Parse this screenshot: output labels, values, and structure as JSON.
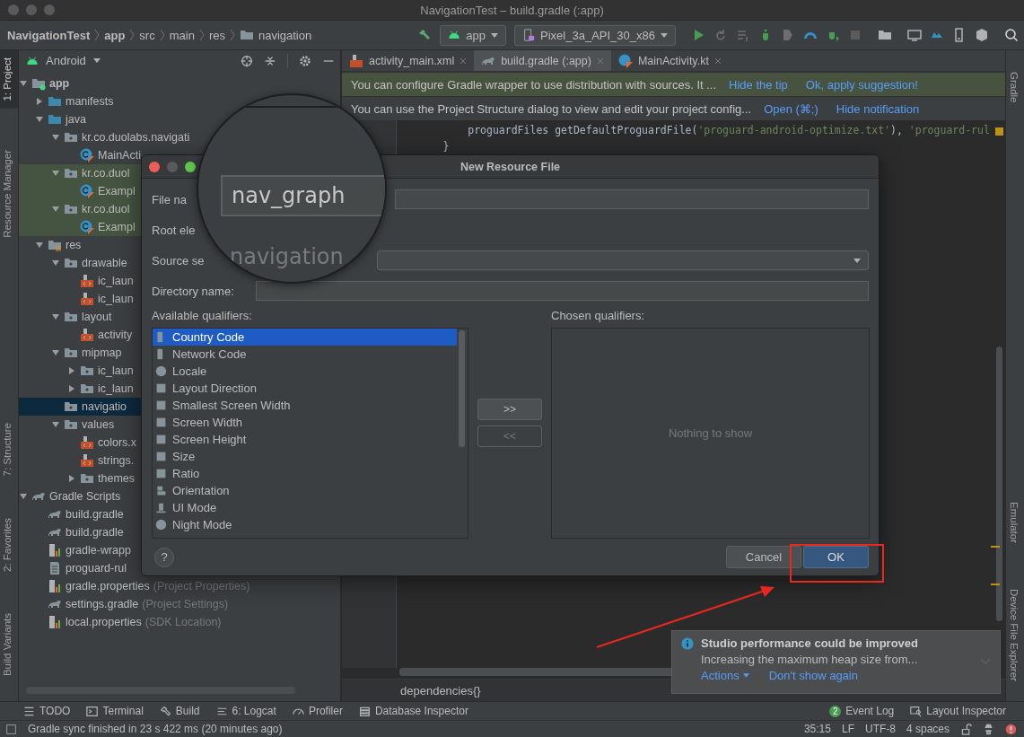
{
  "window": {
    "title": "NavigationTest – build.gradle (:app)"
  },
  "breadcrumbs": [
    {
      "label": "NavigationTest",
      "bold": true,
      "kind": "text"
    },
    {
      "label": "app",
      "bold": true,
      "kind": "text"
    },
    {
      "label": "src",
      "bold": false,
      "kind": "text"
    },
    {
      "label": "main",
      "bold": false,
      "kind": "text"
    },
    {
      "label": "res",
      "bold": false,
      "kind": "text"
    },
    {
      "label": "navigation",
      "bold": false,
      "kind": "folder"
    }
  ],
  "run_config": {
    "module": "app",
    "device": "Pixel_3a_API_30_x86"
  },
  "left_stripe_top": [
    {
      "label": "1: Project",
      "selected": true
    },
    {
      "label": "Resource Manager",
      "selected": false
    }
  ],
  "left_stripe_bottom": [
    {
      "label": "7: Structure",
      "selected": false
    },
    {
      "label": "2: Favorites",
      "selected": false
    },
    {
      "label": "Build Variants",
      "selected": false
    }
  ],
  "project_panel": {
    "view": "Android",
    "tree": [
      {
        "label": "app",
        "kind": "module",
        "expanded": true,
        "selected": false,
        "tinted": false,
        "children": [
          {
            "label": "manifests",
            "kind": "folder",
            "expanded": false,
            "selected": false,
            "tinted": false
          },
          {
            "label": "java",
            "kind": "folder",
            "expanded": true,
            "selected": false,
            "tinted": false,
            "children": [
              {
                "label": "kr.co.duolabs.navigati",
                "kind": "package",
                "expanded": true,
                "selected": false,
                "tinted": false,
                "children": [
                  {
                    "label": "MainActi",
                    "kind": "kotlin",
                    "selected": false,
                    "tinted": false
                  }
                ]
              },
              {
                "label": "kr.co.duol",
                "kind": "package",
                "expanded": true,
                "selected": false,
                "tinted": true,
                "children": [
                  {
                    "label": "Exampl",
                    "kind": "kotlin",
                    "selected": false,
                    "tinted": true
                  }
                ]
              },
              {
                "label": "kr.co.duol",
                "kind": "package",
                "expanded": true,
                "selected": false,
                "tinted": true,
                "children": [
                  {
                    "label": "Exampl",
                    "kind": "kotlin",
                    "selected": false,
                    "tinted": true
                  }
                ]
              }
            ]
          },
          {
            "label": "res",
            "kind": "res",
            "expanded": true,
            "selected": false,
            "tinted": false,
            "children": [
              {
                "label": "drawable",
                "kind": "package",
                "expanded": true,
                "selected": false,
                "tinted": false,
                "children": [
                  {
                    "label": "ic_laun",
                    "kind": "xml",
                    "selected": false,
                    "tinted": false
                  },
                  {
                    "label": "ic_laun",
                    "kind": "xml",
                    "selected": false,
                    "tinted": false
                  }
                ]
              },
              {
                "label": "layout",
                "kind": "package",
                "expanded": true,
                "selected": false,
                "tinted": false,
                "children": [
                  {
                    "label": "activity",
                    "kind": "xml",
                    "selected": false,
                    "tinted": false
                  }
                ]
              },
              {
                "label": "mipmap",
                "kind": "package",
                "expanded": true,
                "selected": false,
                "tinted": false,
                "children": [
                  {
                    "label": "ic_laun",
                    "kind": "package",
                    "expanded": false,
                    "selected": false,
                    "tinted": false
                  },
                  {
                    "label": "ic_laun",
                    "kind": "package",
                    "expanded": false,
                    "selected": false,
                    "tinted": false
                  }
                ]
              },
              {
                "label": "navigatio",
                "kind": "package",
                "selected": true,
                "tinted": false
              },
              {
                "label": "values",
                "kind": "package",
                "expanded": true,
                "selected": false,
                "tinted": false,
                "children": [
                  {
                    "label": "colors.x",
                    "kind": "xml",
                    "selected": false,
                    "tinted": false
                  },
                  {
                    "label": "strings.",
                    "kind": "xml",
                    "selected": false,
                    "tinted": false
                  },
                  {
                    "label": "themes",
                    "kind": "package",
                    "expanded": false,
                    "selected": false,
                    "tinted": false
                  }
                ]
              }
            ]
          }
        ]
      },
      {
        "label": "Gradle Scripts",
        "kind": "gradle",
        "expanded": true,
        "selected": false,
        "tinted": false,
        "children": [
          {
            "label": "build.gradle",
            "kind": "gradle",
            "selected": false,
            "tinted": false
          },
          {
            "label": "build.gradle",
            "kind": "gradle",
            "selected": false,
            "tinted": false
          },
          {
            "label": "gradle-wrapp",
            "kind": "properties",
            "selected": false,
            "tinted": false
          },
          {
            "label": "proguard-rul",
            "kind": "text",
            "selected": false,
            "tinted": false
          },
          {
            "label": "gradle.properties",
            "note": "(Project Properties)",
            "kind": "properties",
            "selected": false,
            "tinted": false
          },
          {
            "label": "settings.gradle",
            "note": "(Project Settings)",
            "kind": "gradle",
            "selected": false,
            "tinted": false
          },
          {
            "label": "local.properties",
            "note": "(SDK Location)",
            "kind": "properties",
            "selected": false,
            "tinted": false
          }
        ]
      }
    ]
  },
  "editor_tabs": [
    {
      "label": "activity_main.xml",
      "kind": "xml",
      "selected": false
    },
    {
      "label": "build.gradle (:app)",
      "kind": "gradle",
      "selected": true
    },
    {
      "label": "MainActivity.kt",
      "kind": "kotlin",
      "selected": false
    }
  ],
  "banners": [
    {
      "kind": "tip",
      "text": "You can configure Gradle wrapper to use distribution with sources. It ...",
      "links": [
        "Hide the tip",
        "Ok, apply suggestion!"
      ]
    },
    {
      "kind": "info",
      "text": "You can use the Project Structure dialog to view and edit your project config...",
      "links": [
        "Open (⌘;)",
        "Hide notification"
      ]
    }
  ],
  "code_lines": [
    {
      "segments": [
        {
          "kind": "plain",
          "text": "          proguardFiles getDefaultProguardFile("
        },
        {
          "kind": "string",
          "text": "'proguard-android-optimize.txt'"
        },
        {
          "kind": "plain",
          "text": "), "
        },
        {
          "kind": "string",
          "text": "'proguard-rul"
        }
      ]
    },
    {
      "segments": [
        {
          "kind": "plain",
          "text": "      }"
        }
      ]
    }
  ],
  "editor_breadcrumb": "dependencies{}",
  "dialog": {
    "title": "New Resource File",
    "fields": [
      {
        "label": "File na",
        "kind": "text"
      },
      {
        "label": "Root ele",
        "kind": "label"
      },
      {
        "label": "Source se",
        "kind": "select"
      },
      {
        "label": "Directory name:",
        "kind": "text"
      }
    ],
    "available_label": "Available qualifiers:",
    "qualifiers": [
      {
        "label": "Country Code",
        "selected": true
      },
      {
        "label": "Network Code",
        "selected": false
      },
      {
        "label": "Locale",
        "selected": false
      },
      {
        "label": "Layout Direction",
        "selected": false
      },
      {
        "label": "Smallest Screen Width",
        "selected": false
      },
      {
        "label": "Screen Width",
        "selected": false
      },
      {
        "label": "Screen Height",
        "selected": false
      },
      {
        "label": "Size",
        "selected": false
      },
      {
        "label": "Ratio",
        "selected": false
      },
      {
        "label": "Orientation",
        "selected": false
      },
      {
        "label": "UI Mode",
        "selected": false
      },
      {
        "label": "Night Mode",
        "selected": false
      }
    ],
    "add_button": {
      "label": ">>",
      "disabled": false
    },
    "remove_button": {
      "label": "<<",
      "disabled": true
    },
    "chosen_label": "Chosen qualifiers:",
    "empty_text": "Nothing to show",
    "help": "?",
    "cancel": "Cancel",
    "ok": "OK"
  },
  "magnifier": {
    "file_name": "nav_graph",
    "root_element": "navigation"
  },
  "notification": {
    "title": "Studio performance could be improved",
    "body": "Increasing the maximum heap size from...",
    "actions": "Actions",
    "dismiss": "Don't show again"
  },
  "right_stripe": [
    {
      "label": "Gradle"
    },
    {
      "label": "Emulator"
    },
    {
      "label": "Device File Explorer"
    }
  ],
  "bottom_tools_left": [
    "TODO",
    "Terminal",
    "Build",
    "6: Logcat",
    "Profiler",
    "Database Inspector"
  ],
  "bottom_tools_right": [
    {
      "label": "Event Log",
      "badge": "2"
    },
    {
      "label": "Layout Inspector"
    }
  ],
  "status": {
    "message": "Gradle sync finished in 23 s 422 ms (20 minutes ago)",
    "items": [
      "35:15",
      "LF",
      "UTF-8",
      "4 spaces"
    ]
  }
}
